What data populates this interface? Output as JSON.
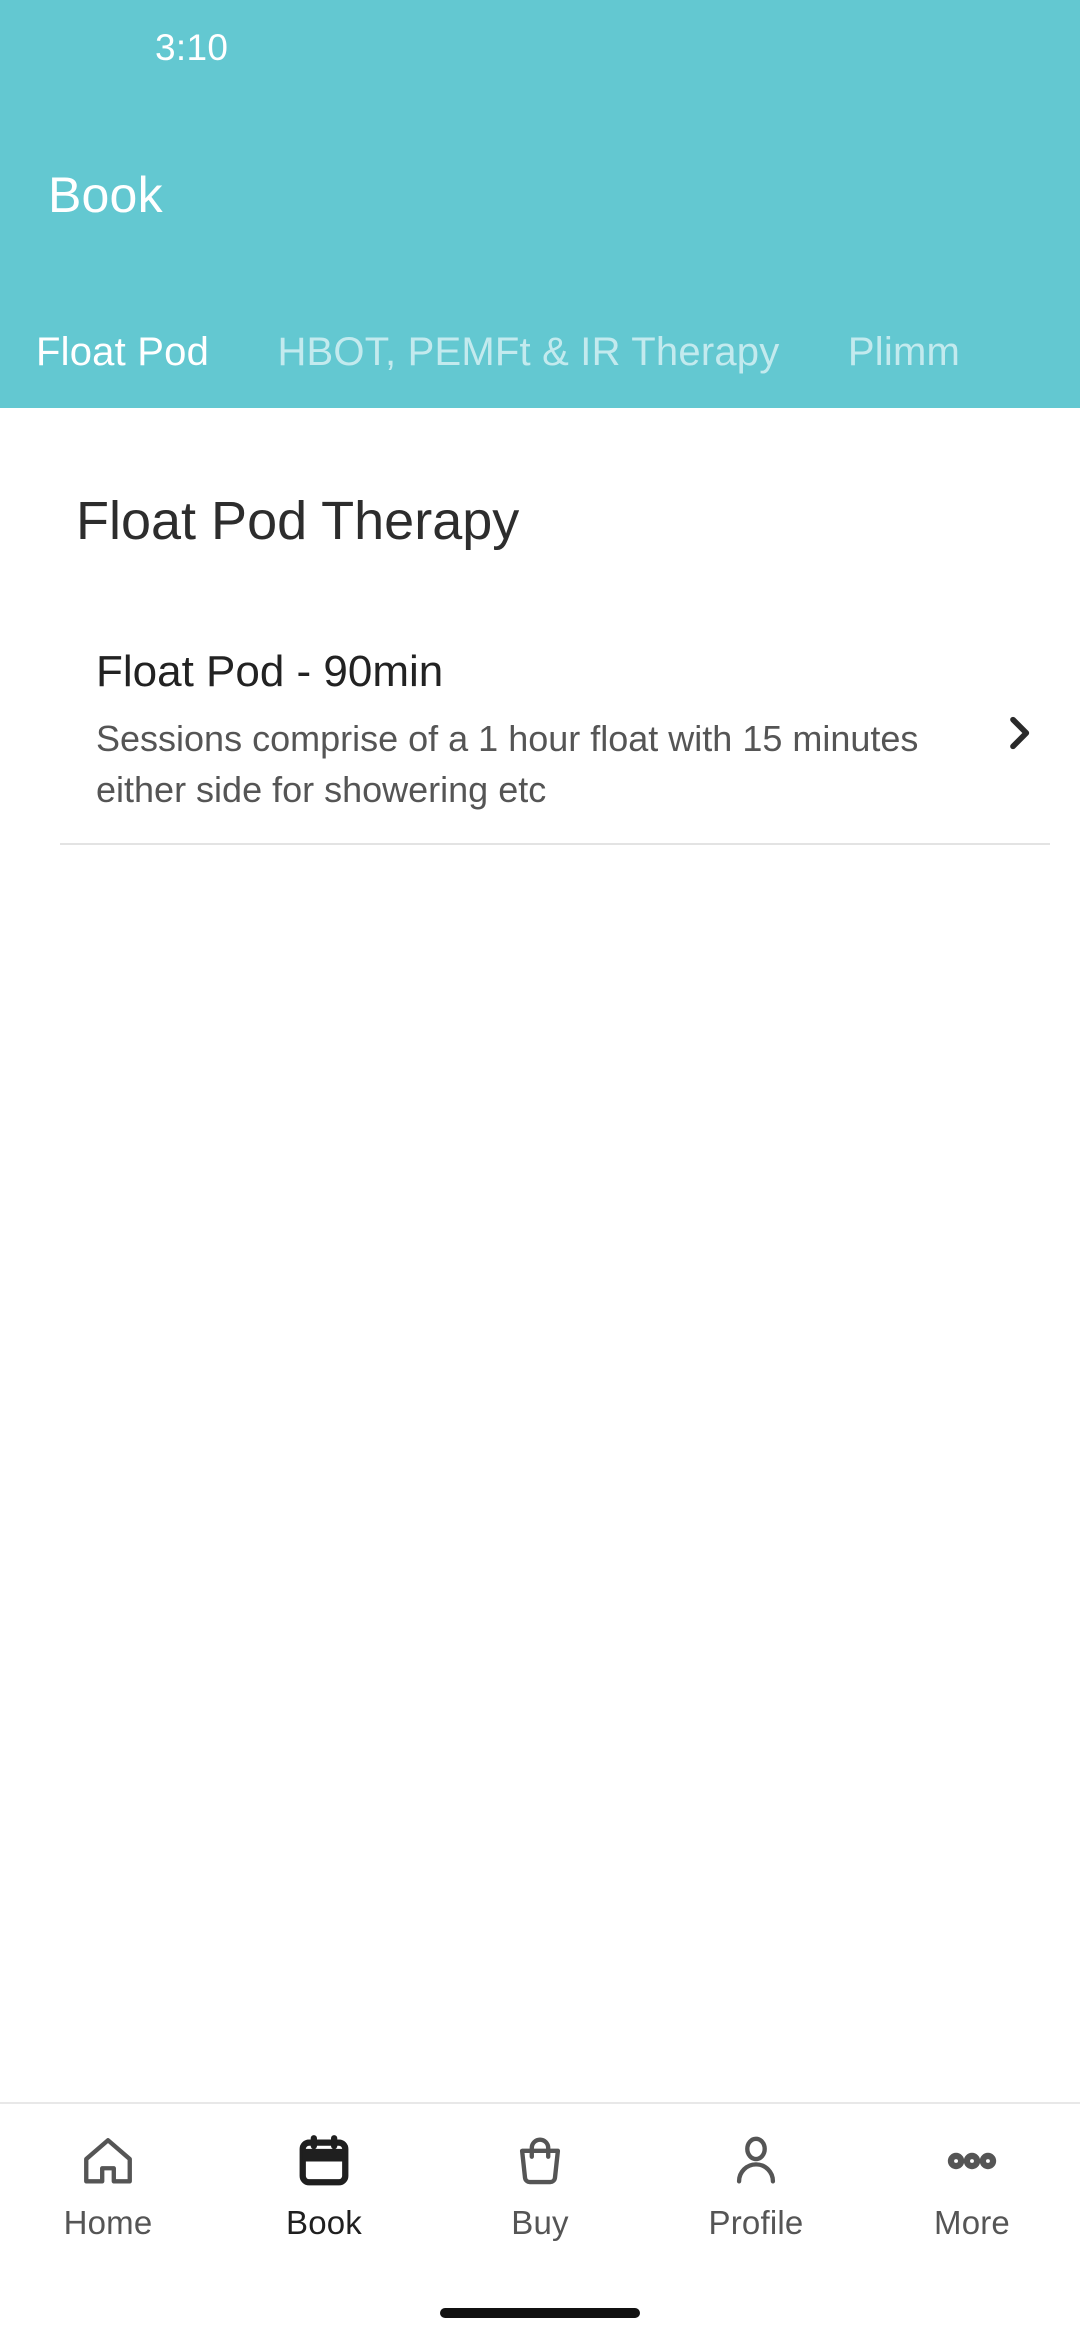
{
  "status_bar": {
    "time": "3:10"
  },
  "header": {
    "title": "Book",
    "background_color": "#63c8d1",
    "tabs": [
      {
        "label": "Float Pod",
        "active": true
      },
      {
        "label": "HBOT, PEMFt & IR Therapy",
        "active": false
      },
      {
        "label": "Plimm",
        "active": false,
        "truncated": true
      }
    ]
  },
  "content": {
    "section_title": "Float Pod Therapy",
    "services": [
      {
        "name": "Float Pod - 90min",
        "description": "Sessions comprise of a 1 hour float with 15 minutes either side for showering etc",
        "chevron": "chevron-right-icon"
      }
    ]
  },
  "bottom_nav": {
    "items": [
      {
        "label": "Home",
        "icon": "home-icon",
        "active": false
      },
      {
        "label": "Book",
        "icon": "calendar-icon",
        "active": true
      },
      {
        "label": "Buy",
        "icon": "bag-icon",
        "active": false
      },
      {
        "label": "Profile",
        "icon": "person-icon",
        "active": false
      },
      {
        "label": "More",
        "icon": "ellipsis-icon",
        "active": false
      }
    ]
  }
}
